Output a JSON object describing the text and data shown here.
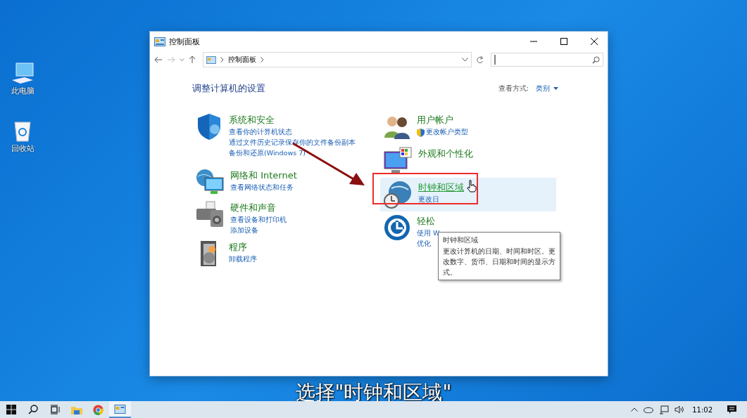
{
  "desktop_icons": [
    {
      "label": "此电脑"
    },
    {
      "label": "回收站"
    }
  ],
  "window": {
    "title": "控制面板",
    "breadcrumb": "控制面板",
    "heading": "调整计算机的设置",
    "view_by_label": "查看方式:",
    "view_by_value": "类别",
    "columns": [
      [
        {
          "title": "系统和安全",
          "selected": false,
          "links": [
            "查看你的计算机状态",
            "通过文件历史记录保存你的文件备份副本",
            "备份和还原(Windows 7)"
          ]
        },
        {
          "title": "网络和 Internet",
          "selected": false,
          "links": [
            "查看网络状态和任务"
          ]
        },
        {
          "title": "硬件和声音",
          "selected": false,
          "links": [
            "查看设备和打印机",
            "添加设备"
          ]
        },
        {
          "title": "程序",
          "selected": false,
          "links": [
            "卸载程序"
          ]
        }
      ],
      [
        {
          "title": "用户帐户",
          "selected": false,
          "links": [
            "更改帐户类型"
          ]
        },
        {
          "title": "外观和个性化",
          "selected": false
        },
        {
          "title": "时钟和区域",
          "selected": true,
          "links": [
            "更改日"
          ]
        },
        {
          "title": "轻松",
          "selected": false,
          "links": [
            "使用 W",
            "优化"
          ]
        }
      ]
    ],
    "tooltip": {
      "title": "时钟和区域",
      "text": "更改计算机的日期、时间和时区。更改数字、货币、日期和时间的显示方式。"
    }
  },
  "caption": "选择\"时钟和区域\"",
  "taskbar": {
    "time": "11:02"
  }
}
